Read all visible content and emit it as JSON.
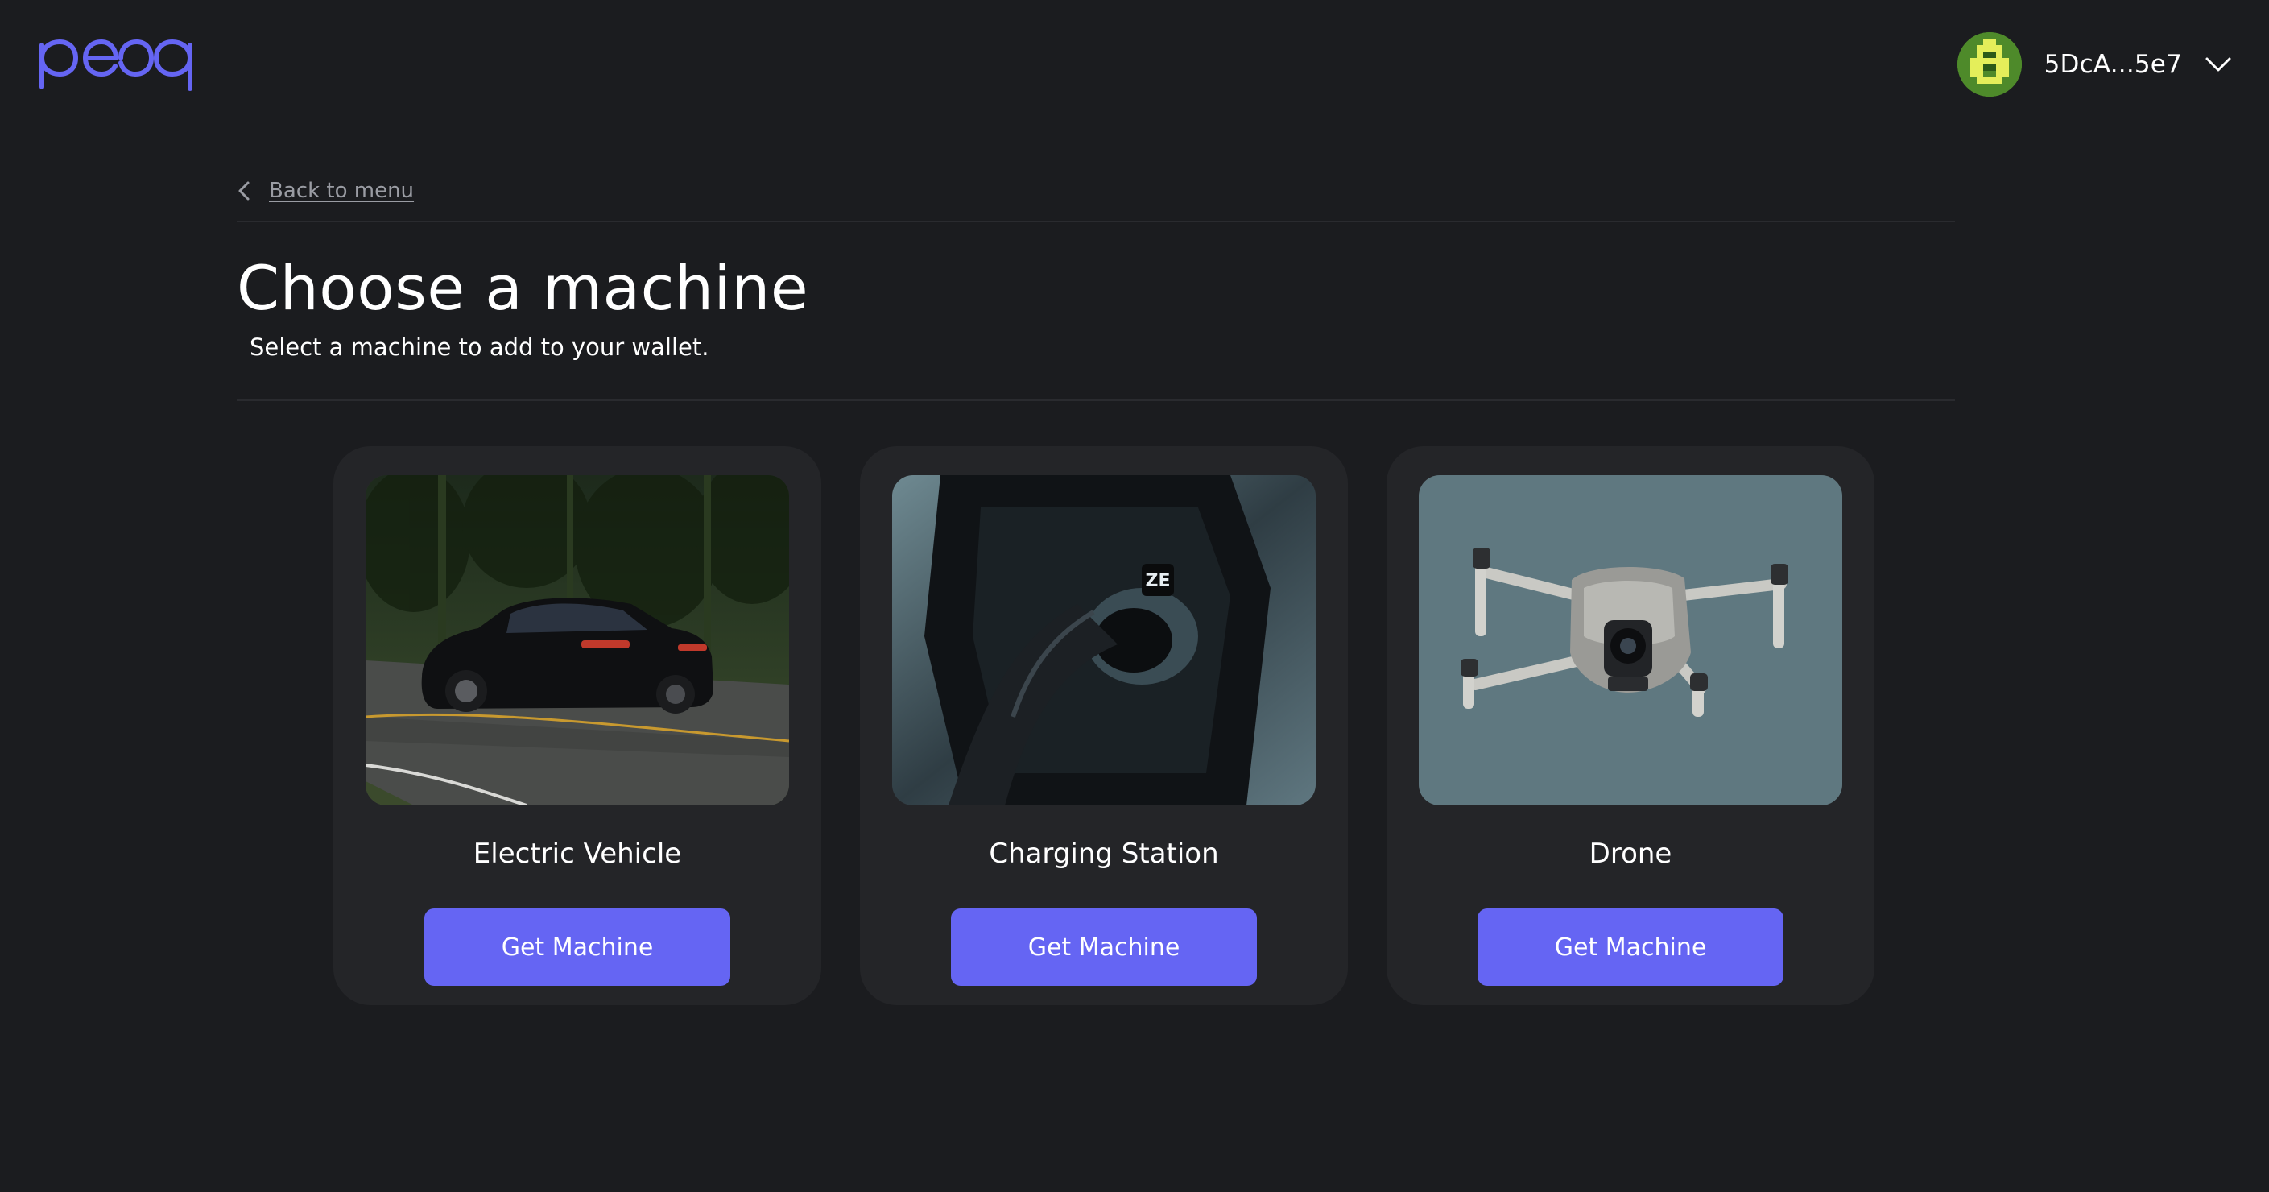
{
  "header": {
    "logo_text": "peaq",
    "account": {
      "address": "5DcA...5e7"
    }
  },
  "nav": {
    "back_label": "Back to menu"
  },
  "main": {
    "title": "Choose a machine",
    "subtitle": "Select a machine to add to your wallet."
  },
  "colors": {
    "background": "#1b1c1f",
    "card": "#242528",
    "accent": "#6565f3",
    "logo": "#6565f3"
  },
  "machines": [
    {
      "name": "Electric Vehicle",
      "button_label": "Get Machine",
      "image": "electric-vehicle-photo"
    },
    {
      "name": "Charging Station",
      "button_label": "Get Machine",
      "image": "charging-station-photo"
    },
    {
      "name": "Drone",
      "button_label": "Get Machine",
      "image": "drone-photo"
    }
  ]
}
